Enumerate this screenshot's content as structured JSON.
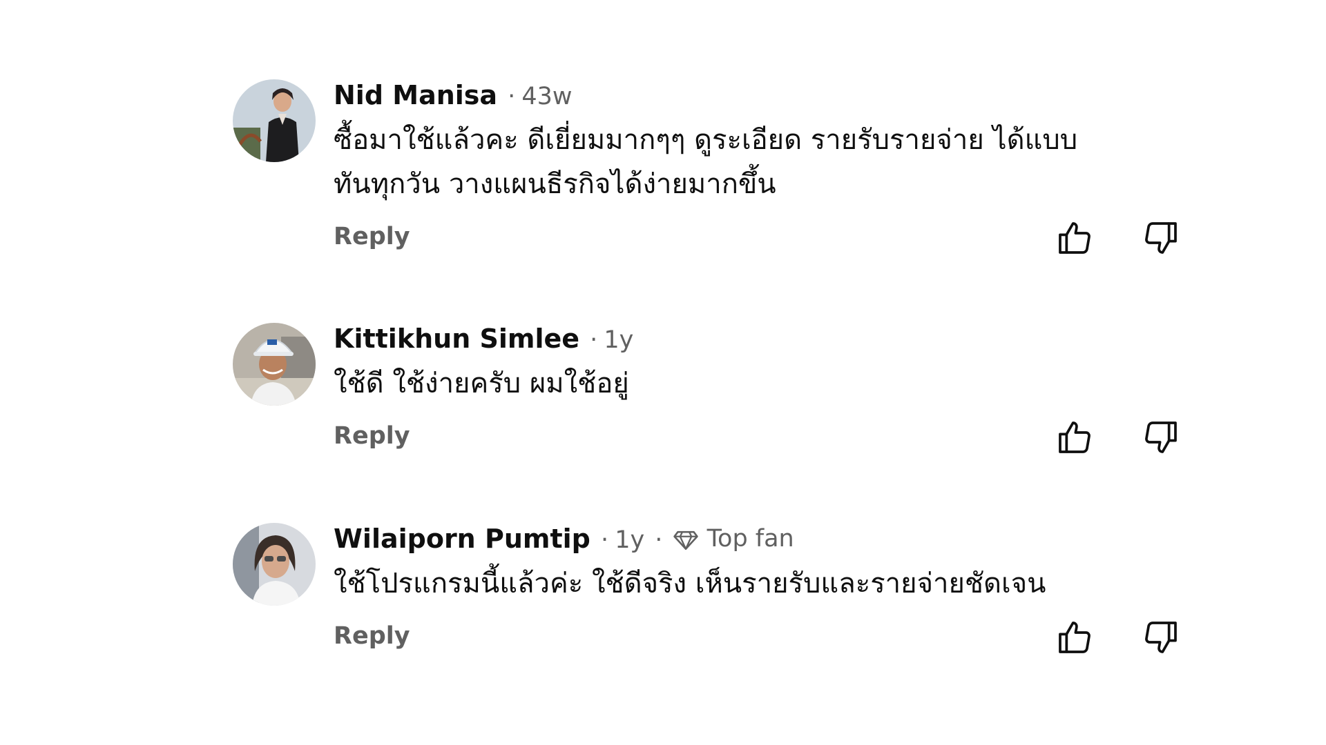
{
  "comments": [
    {
      "author": "Nid Manisa",
      "time": "43w",
      "text": "ซื้อมาใช้แล้วคะ ดีเยี่ยมมากๆๆ ดูระเอียด รายรับรายจ่าย ได้แบบทันทุกวัน วางแผนธีรกิจได้ง่ายมากขึ้น",
      "reply_label": "Reply",
      "separator": "·"
    },
    {
      "author": "Kittikhun Simlee",
      "time": "1y",
      "text": "ใช้ดี ใช้ง่ายครับ ผมใช้อยู่",
      "reply_label": "Reply",
      "separator": "·"
    },
    {
      "author": "Wilaiporn Pumtip",
      "time": "1y",
      "badge": "Top fan",
      "text": "ใช้โปรแกรมนี้แล้วค่ะ ใช้ดีจริง เห็นรายรับและรายจ่ายชัดเจน",
      "reply_label": "Reply",
      "separator": "·"
    }
  ],
  "icons": {
    "like": "thumb-up-icon",
    "dislike": "thumb-down-icon",
    "badge": "diamond-icon"
  },
  "colors": {
    "text": "#0f0f0f",
    "secondary": "#606060",
    "background": "#ffffff"
  }
}
